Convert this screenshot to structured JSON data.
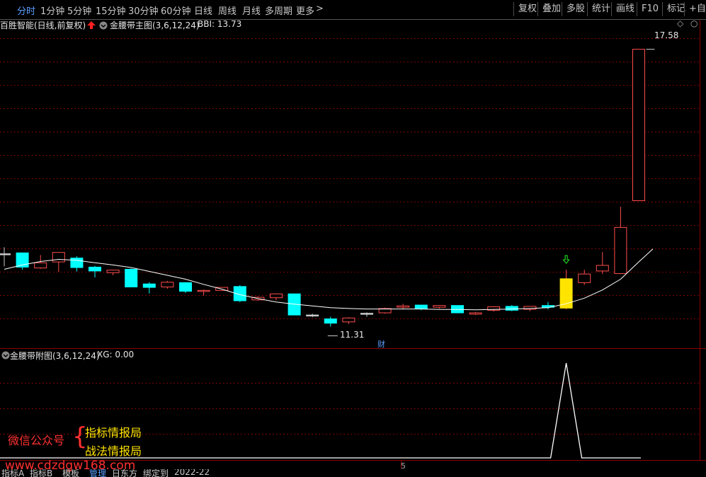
{
  "toolbar": {
    "periods": [
      "分时",
      "1分钟",
      "5分钟",
      "15分钟",
      "30分钟",
      "60分钟",
      "日线",
      "周线",
      "月线",
      "多周期",
      "更多"
    ],
    "active_period": "分时",
    "right_buttons": [
      "复权",
      "叠加",
      "多股",
      "统计",
      "画线",
      "F10",
      "标记",
      "+自选"
    ]
  },
  "main_panel": {
    "stock_title": "百胜智能(日线,前复权)",
    "indicator_label": "金腰带主图(3,6,12,24)",
    "bbi_label": "BBI: 13.73"
  },
  "sub_panel": {
    "indicator_label": "金腰带附图(3,6,12,24)",
    "xg_label": "XG: 0.00"
  },
  "annotations": {
    "high_price": "17.58",
    "low_price": "11.31",
    "finance_marker": "财",
    "axis_tick": "5"
  },
  "watermark": {
    "wechat": "微信公众号",
    "brace": "{",
    "line1": "指标情报局",
    "line2": "战法情报局",
    "url": "www.cdzdgw168.com"
  },
  "bottom_tabs": [
    "指标A",
    "指标B",
    "模板",
    "管理",
    "日东方",
    "绑定到",
    "2022-22"
  ],
  "colors": {
    "background": "#000000",
    "up": "#ff4d4d",
    "down": "#00ffff",
    "signal": "#ffe400",
    "grid": "#7a0000",
    "bbi_line": "#ffffff",
    "active_tab": "#5aa0ff",
    "watermark_red": "#ff3030",
    "watermark_yellow": "#ffe400"
  },
  "chart_data": {
    "type": "candlestick",
    "title": "百胜智能(日线,前复权)",
    "bars": [
      {
        "o": 12.84,
        "c": 12.84,
        "h": 12.99,
        "l": 12.55,
        "dir": "flat"
      },
      {
        "o": 12.86,
        "c": 12.53,
        "h": 12.86,
        "l": 12.47,
        "dir": "down"
      },
      {
        "o": 12.51,
        "c": 12.63,
        "h": 12.81,
        "l": 12.49,
        "dir": "up"
      },
      {
        "o": 12.65,
        "c": 12.87,
        "h": 12.87,
        "l": 12.42,
        "dir": "up"
      },
      {
        "o": 12.74,
        "c": 12.52,
        "h": 12.78,
        "l": 12.43,
        "dir": "down"
      },
      {
        "o": 12.53,
        "c": 12.44,
        "h": 12.56,
        "l": 12.29,
        "dir": "down"
      },
      {
        "o": 12.46,
        "c": 12.4,
        "h": 12.47,
        "l": 12.34,
        "dir": "up"
      },
      {
        "o": 12.48,
        "c": 12.07,
        "h": 12.5,
        "l": 12.07,
        "dir": "down"
      },
      {
        "o": 12.14,
        "c": 12.06,
        "h": 12.18,
        "l": 11.92,
        "dir": "down"
      },
      {
        "o": 12.07,
        "c": 12.18,
        "h": 12.21,
        "l": 12.03,
        "dir": "up"
      },
      {
        "o": 12.17,
        "c": 11.97,
        "h": 12.18,
        "l": 11.93,
        "dir": "down"
      },
      {
        "o": 11.99,
        "c": 11.97,
        "h": 12.01,
        "l": 11.87,
        "dir": "up"
      },
      {
        "o": 11.99,
        "c": 12.06,
        "h": 12.06,
        "l": 12.04,
        "dir": "up"
      },
      {
        "o": 12.08,
        "c": 11.75,
        "h": 12.11,
        "l": 11.72,
        "dir": "down"
      },
      {
        "o": 11.77,
        "c": 11.83,
        "h": 11.85,
        "l": 11.75,
        "dir": "up"
      },
      {
        "o": 11.82,
        "c": 11.91,
        "h": 11.92,
        "l": 11.76,
        "dir": "up"
      },
      {
        "o": 11.91,
        "c": 11.42,
        "h": 11.91,
        "l": 11.42,
        "dir": "down"
      },
      {
        "o": 11.42,
        "c": 11.4,
        "h": 11.45,
        "l": 11.37,
        "dir": "flat"
      },
      {
        "o": 11.33,
        "c": 11.23,
        "h": 11.38,
        "l": 11.15,
        "dir": "down"
      },
      {
        "o": 11.26,
        "c": 11.35,
        "h": 11.37,
        "l": 11.21,
        "dir": "up"
      },
      {
        "o": 11.46,
        "c": 11.44,
        "h": 11.48,
        "l": 11.38,
        "dir": "flat"
      },
      {
        "o": 11.47,
        "c": 11.57,
        "h": 11.59,
        "l": 11.45,
        "dir": "up"
      },
      {
        "o": 11.6,
        "c": 11.63,
        "h": 11.68,
        "l": 11.55,
        "dir": "up"
      },
      {
        "o": 11.65,
        "c": 11.56,
        "h": 11.65,
        "l": 11.53,
        "dir": "down"
      },
      {
        "o": 11.6,
        "c": 11.64,
        "h": 11.64,
        "l": 11.57,
        "dir": "up"
      },
      {
        "o": 11.64,
        "c": 11.47,
        "h": 11.64,
        "l": 11.46,
        "dir": "down"
      },
      {
        "o": 11.44,
        "c": 11.47,
        "h": 11.49,
        "l": 11.42,
        "dir": "up"
      },
      {
        "o": 11.53,
        "c": 11.61,
        "h": 11.62,
        "l": 11.5,
        "dir": "up"
      },
      {
        "o": 11.62,
        "c": 11.53,
        "h": 11.65,
        "l": 11.51,
        "dir": "down"
      },
      {
        "o": 11.55,
        "c": 11.62,
        "h": 11.62,
        "l": 11.51,
        "dir": "up"
      },
      {
        "o": 11.64,
        "c": 11.6,
        "h": 11.72,
        "l": 11.55,
        "dir": "down"
      },
      {
        "o": 11.58,
        "c": 12.26,
        "h": 12.47,
        "l": 11.55,
        "dir": "signal"
      },
      {
        "o": 12.17,
        "c": 12.37,
        "h": 12.47,
        "l": 12.12,
        "dir": "up"
      },
      {
        "o": 12.44,
        "c": 12.57,
        "h": 12.88,
        "l": 12.37,
        "dir": "up"
      },
      {
        "o": 12.38,
        "c": 13.45,
        "h": 13.93,
        "l": 12.38,
        "dir": "up"
      },
      {
        "o": 14.07,
        "c": 17.58,
        "h": 17.58,
        "l": 14.07,
        "dir": "up"
      }
    ],
    "bbi": [
      12.48,
      12.58,
      12.66,
      12.71,
      12.69,
      12.63,
      12.58,
      12.52,
      12.43,
      12.34,
      12.25,
      12.13,
      12.02,
      11.89,
      11.8,
      11.72,
      11.67,
      11.63,
      11.59,
      11.57,
      11.56,
      11.56,
      11.56,
      11.56,
      11.55,
      11.55,
      11.54,
      11.55,
      11.56,
      11.57,
      11.59,
      11.68,
      11.81,
      12.0,
      12.25,
      12.65
    ],
    "signal_index": 31,
    "xg": {
      "peak_index": 31,
      "peak_value": 1,
      "baseline": 0
    },
    "ylim_price": [
      10.88,
      18.0
    ],
    "grid": true,
    "subtitle": "金腰带主图(3,6,12,24)"
  }
}
